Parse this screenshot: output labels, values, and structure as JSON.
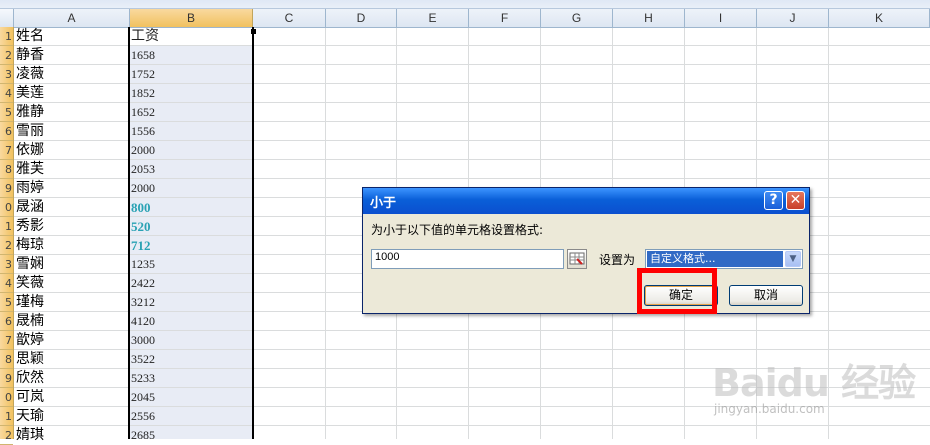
{
  "spreadsheet": {
    "columns": [
      "A",
      "B",
      "C",
      "D",
      "E",
      "F",
      "G",
      "H",
      "I",
      "J",
      "K"
    ],
    "selected_column": "B",
    "row_numbers": [
      "1",
      "2",
      "3",
      "4",
      "5",
      "6",
      "7",
      "8",
      "9",
      "0",
      "1",
      "2",
      "3",
      "4",
      "5",
      "6",
      "7",
      "8",
      "9",
      "0",
      "1",
      "2"
    ],
    "header": {
      "name": "姓名",
      "salary": "工资"
    },
    "rows": [
      {
        "name": "静香",
        "salary": "1658",
        "highlight": false
      },
      {
        "name": "凌薇",
        "salary": "1752",
        "highlight": false
      },
      {
        "name": "美莲",
        "salary": "1852",
        "highlight": false
      },
      {
        "name": "雅静",
        "salary": "1652",
        "highlight": false
      },
      {
        "name": "雪丽",
        "salary": "1556",
        "highlight": false
      },
      {
        "name": "依娜",
        "salary": "2000",
        "highlight": false
      },
      {
        "name": "雅芙",
        "salary": "2053",
        "highlight": false
      },
      {
        "name": "雨婷",
        "salary": "2000",
        "highlight": false
      },
      {
        "name": "晟涵",
        "salary": "800",
        "highlight": true
      },
      {
        "name": "秀影",
        "salary": "520",
        "highlight": true
      },
      {
        "name": "梅琼",
        "salary": "712",
        "highlight": true
      },
      {
        "name": "雪娴",
        "salary": "1235",
        "highlight": false
      },
      {
        "name": "笑薇",
        "salary": "2422",
        "highlight": false
      },
      {
        "name": "瑾梅",
        "salary": "3212",
        "highlight": false
      },
      {
        "name": "晟楠",
        "salary": "4120",
        "highlight": false
      },
      {
        "name": "歆婷",
        "salary": "3000",
        "highlight": false
      },
      {
        "name": "思颖",
        "salary": "3522",
        "highlight": false
      },
      {
        "name": "欣然",
        "salary": "5233",
        "highlight": false
      },
      {
        "name": "可岚",
        "salary": "2045",
        "highlight": false
      },
      {
        "name": "天瑜",
        "salary": "2556",
        "highlight": false
      },
      {
        "name": "婧琪",
        "salary": "2685",
        "highlight": false
      }
    ],
    "highlight_color": "#29a2b4"
  },
  "dialog": {
    "title": "小于",
    "help_label": "?",
    "close_label": "✕",
    "prompt": "为小于以下值的单元格设置格式:",
    "threshold_value": "1000",
    "set_as_label": "设置为",
    "format_value": "自定义格式...",
    "dropdown_arrow": "▼",
    "ok_label": "确定",
    "cancel_label": "取消"
  },
  "annotation": {
    "color": "#ff0000"
  },
  "watermark": {
    "text": "Baidu 经验",
    "sub": "jingyan.baidu.com"
  }
}
